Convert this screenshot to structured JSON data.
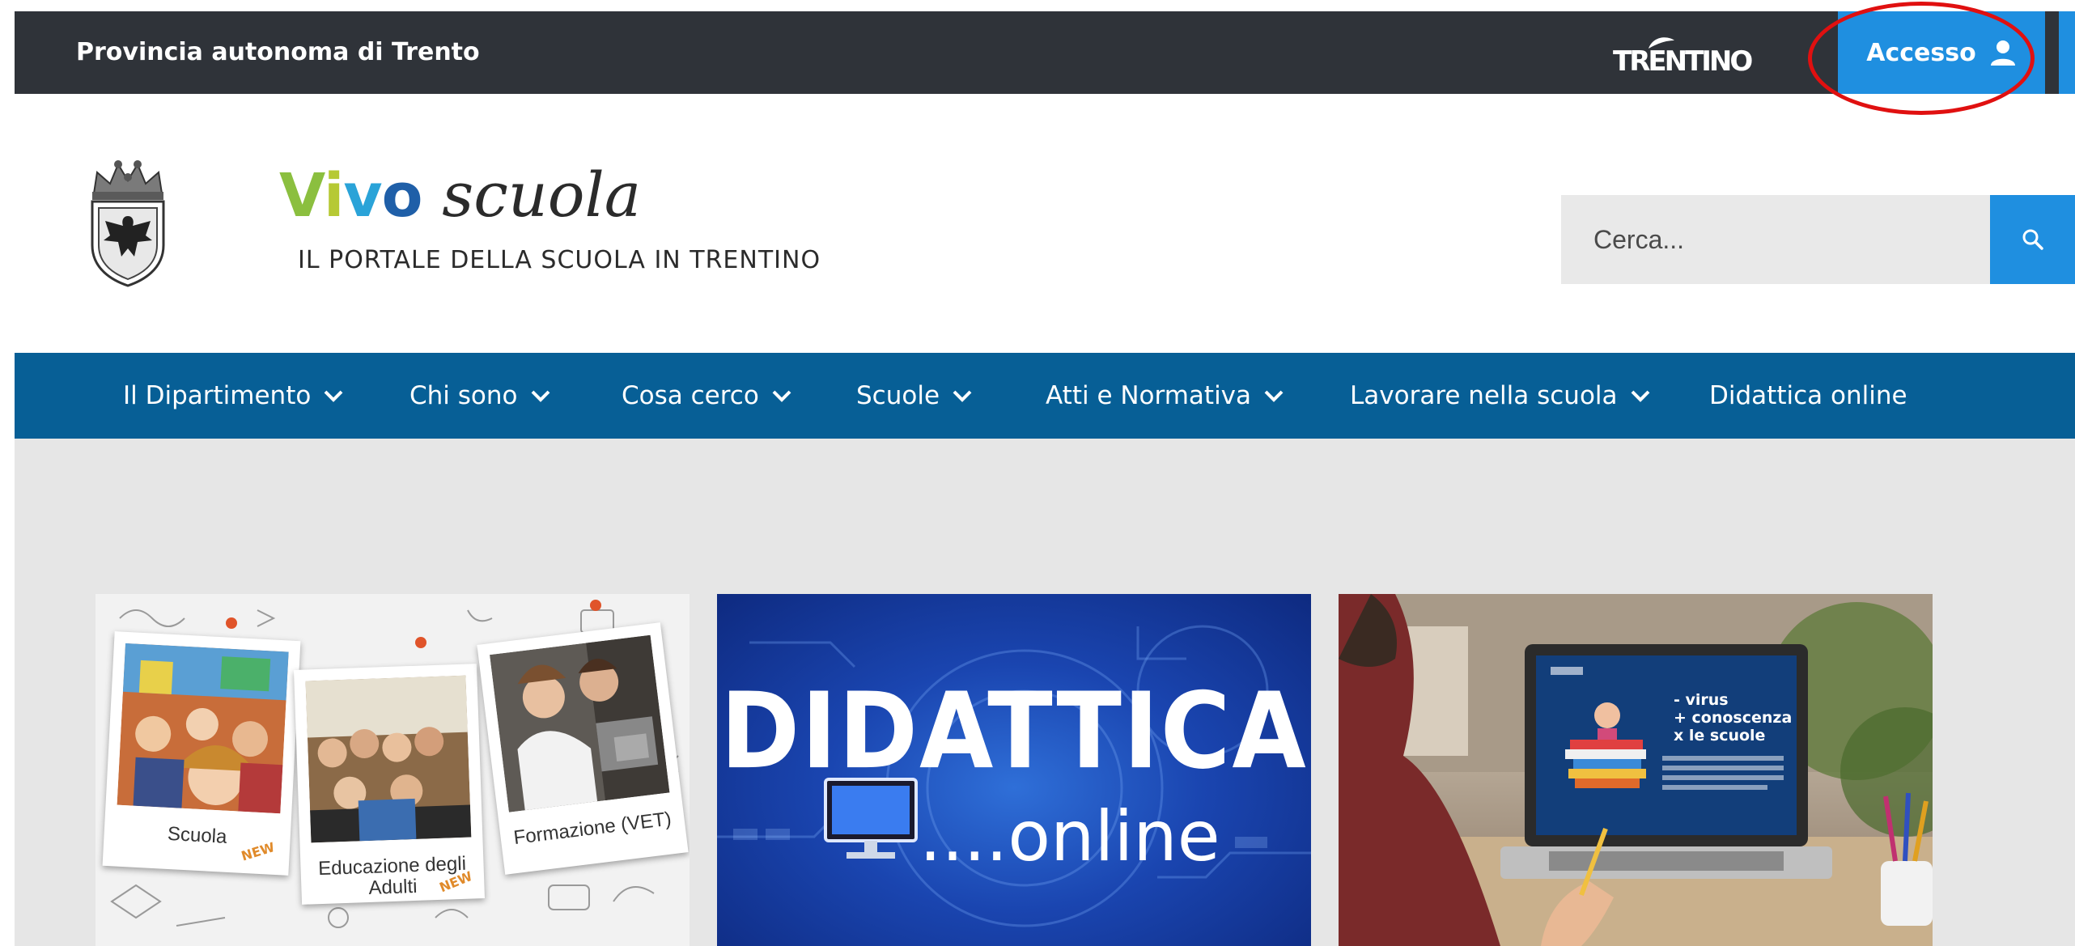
{
  "topbar": {
    "title": "Provincia autonoma di Trento",
    "trentino_logo": "TRENTINO",
    "login_label": "Accesso",
    "login_icon": "user-icon"
  },
  "header": {
    "brand_prefix": [
      "V",
      "i",
      "v",
      "o"
    ],
    "brand_suffix": "scuola",
    "tagline": "IL PORTALE DELLA SCUOLA IN TRENTINO",
    "crest_icon": "coat-of-arms-icon"
  },
  "search": {
    "placeholder": "Cerca...",
    "icon": "search-icon"
  },
  "nav": {
    "items": [
      {
        "label": "Il Dipartimento",
        "dropdown": true
      },
      {
        "label": "Chi sono",
        "dropdown": true
      },
      {
        "label": "Cosa cerco",
        "dropdown": true
      },
      {
        "label": "Scuole",
        "dropdown": true
      },
      {
        "label": "Atti e Normativa",
        "dropdown": true
      },
      {
        "label": "Lavorare nella scuola",
        "dropdown": true
      },
      {
        "label": "Didattica online",
        "dropdown": false
      }
    ]
  },
  "cards": [
    {
      "polaroids": [
        {
          "caption": "Scuola",
          "tag": "NEW"
        },
        {
          "caption": "Educazione degli Adulti",
          "tag": "NEW"
        },
        {
          "caption": "Formazione (VET)"
        }
      ]
    },
    {
      "title": "DIDATTICA",
      "subtitle": "....online"
    },
    {
      "screen_lines": [
        "- virus",
        "+ conoscenza",
        "x le scuole"
      ]
    }
  ],
  "colors": {
    "topbar_bg": "#2f3339",
    "accent_blue": "#1f8fe0",
    "nav_bg": "#075f96",
    "content_bg": "#e6e6e6",
    "highlight_ring": "#e01010"
  }
}
